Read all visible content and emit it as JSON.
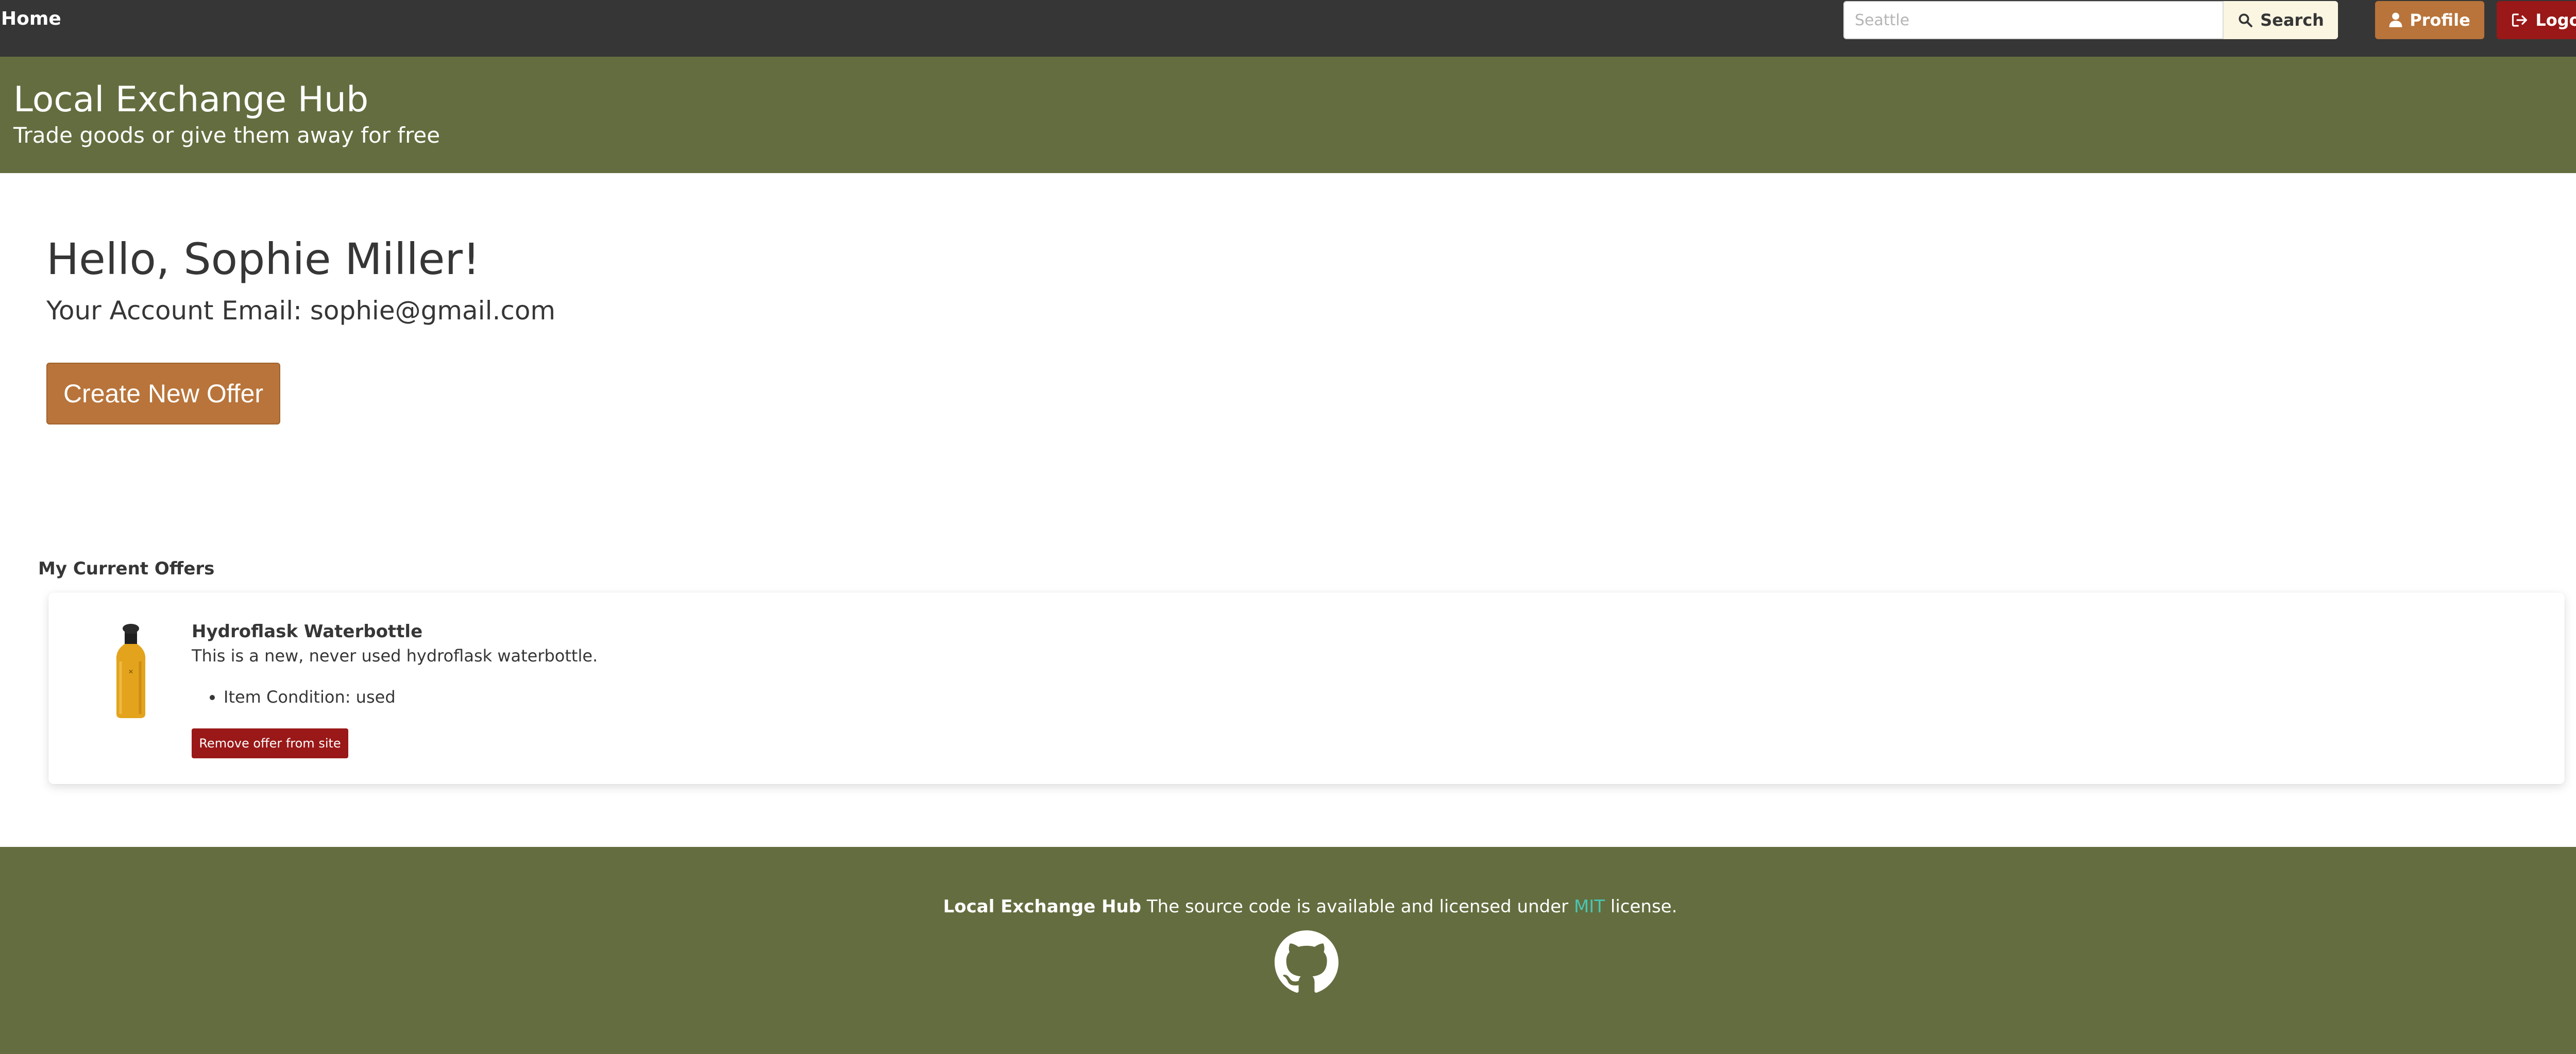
{
  "nav": {
    "home_label": "Home",
    "search_placeholder": "Seattle",
    "search_label": "Search",
    "profile_label": "Profile",
    "logout_label": "Logout"
  },
  "hero": {
    "title": "Local Exchange Hub",
    "subtitle": "Trade goods or give them away for free"
  },
  "account": {
    "greeting": "Hello, Sophie Miller!",
    "email_line": "Your Account Email: sophie@gmail.com",
    "create_offer_label": "Create New Offer"
  },
  "offers": {
    "heading": "My Current Offers",
    "items": [
      {
        "title": "Hydroflask Waterbottle",
        "description": "This is a new, never used hydroflask waterbottle.",
        "condition": "Item Condition: used",
        "remove_label": "Remove offer from site"
      }
    ]
  },
  "footer": {
    "brand": "Local Exchange Hub",
    "text_before": "The source code is available and licensed under",
    "license_link": "MIT",
    "text_after": "license."
  },
  "colors": {
    "navbar": "#363636",
    "hero": "#646d3f",
    "accent_orange": "#b8743a",
    "danger_red": "#9a1818",
    "search_button": "#fbf6e2",
    "link": "#48c7b4"
  },
  "icons": {
    "search": "search-icon",
    "profile": "user-icon",
    "logout": "logout-icon",
    "github": "github-icon"
  }
}
